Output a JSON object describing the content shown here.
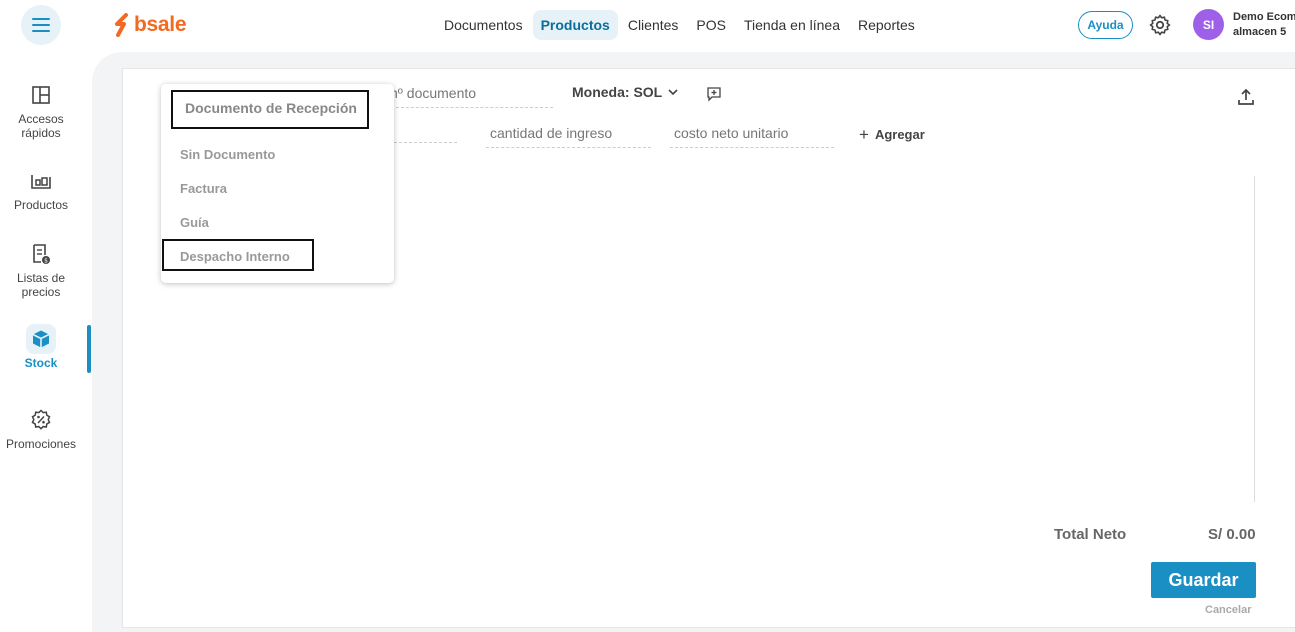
{
  "header": {
    "logo_text": "bsale",
    "nav": [
      {
        "label": "Documentos"
      },
      {
        "label": "Productos",
        "active": true
      },
      {
        "label": "Clientes"
      },
      {
        "label": "POS"
      },
      {
        "label": "Tienda en línea"
      },
      {
        "label": "Reportes"
      }
    ],
    "help_label": "Ayuda",
    "avatar_initials": "SI",
    "user_line1": "Demo Ecom",
    "user_line2": "almacen 5"
  },
  "sidebar": {
    "items": [
      {
        "label_line1": "Accesos",
        "label_line2": "rápidos",
        "icon": "grid-icon"
      },
      {
        "label_line1": "Productos",
        "label_line2": "",
        "icon": "products-icon"
      },
      {
        "label_line1": "Listas de",
        "label_line2": "precios",
        "icon": "price-list-icon"
      },
      {
        "label_line1": "Stock",
        "label_line2": "",
        "icon": "box-icon",
        "active": true
      },
      {
        "label_line1": "Promociones",
        "label_line2": "",
        "icon": "promo-icon"
      }
    ]
  },
  "form": {
    "doc_number_placeholder": "nº documento",
    "currency_label": "Moneda: SOL",
    "quantity_placeholder": "cantidad de ingreso",
    "cost_placeholder": "costo neto unitario",
    "add_label": "Agregar"
  },
  "totals": {
    "label": "Total Neto",
    "value": "S/ 0.00"
  },
  "actions": {
    "save_label": "Guardar",
    "cancel_label": "Cancelar"
  },
  "dropdown": {
    "header": "Documento de Recepción",
    "options": [
      "Sin Documento",
      "Factura",
      "Guía",
      "Despacho Interno"
    ]
  },
  "colors": {
    "accent": "#1a8fc4",
    "brand": "#f26a21",
    "avatar": "#a05fe8"
  }
}
